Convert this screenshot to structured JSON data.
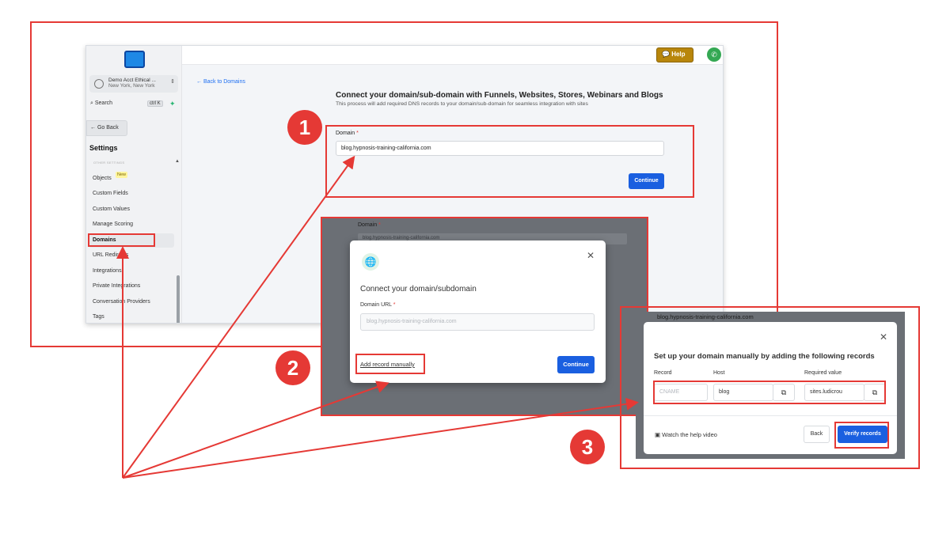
{
  "panel1": {
    "account": {
      "name": "Demo Acct Ethical ...",
      "location": "New York, New York"
    },
    "search": {
      "label": "Search",
      "shortcut": "ctrl K"
    },
    "go_back": "← Go Back",
    "settings_title": "Settings",
    "section_label": "OTHER SETTINGS",
    "sidebar_items": [
      {
        "label": "Objects",
        "badge": "New"
      },
      {
        "label": "Custom Fields"
      },
      {
        "label": "Custom Values"
      },
      {
        "label": "Manage Scoring"
      },
      {
        "label": "Domains",
        "active": true
      },
      {
        "label": "URL Redirects"
      },
      {
        "label": "Integrations"
      },
      {
        "label": "Private Integrations"
      },
      {
        "label": "Conversation Providers"
      },
      {
        "label": "Tags"
      }
    ],
    "help_label": "Help",
    "back_link": "← Back to Domains",
    "heading": "Connect your domain/sub-domain with Funnels, Websites, Stores, Webinars and Blogs",
    "subheading": "This process will add required DNS records to your domain/sub-domain for seamless integration with sites",
    "domain_label": "Domain",
    "domain_value": "blog.hypnosis-training-california.com",
    "continue_label": "Continue"
  },
  "panel2": {
    "bg_label": "Domain",
    "bg_value": "blog.hypnosis-training-california.com",
    "modal_title": "Connect your domain/subdomain",
    "url_label": "Domain URL",
    "url_placeholder": "blog.hypnosis-training-california.com",
    "add_manually": "Add record manually",
    "continue_label": "Continue"
  },
  "panel3": {
    "bg_domain": "blog.hypnosis-training-california.com",
    "title": "Set up your domain manually by adding the following records",
    "columns": [
      "Record",
      "Host",
      "Required value"
    ],
    "row": {
      "record": "CNAME",
      "host": "blog",
      "value": "sites.ludicrou"
    },
    "help_video": "Watch the help video",
    "back_label": "Back",
    "verify_label": "Verify records"
  },
  "steps": [
    "1",
    "2",
    "3"
  ],
  "colors": {
    "annotation": "#e53935",
    "primary": "#1a5fe0",
    "help": "#b8860b"
  }
}
